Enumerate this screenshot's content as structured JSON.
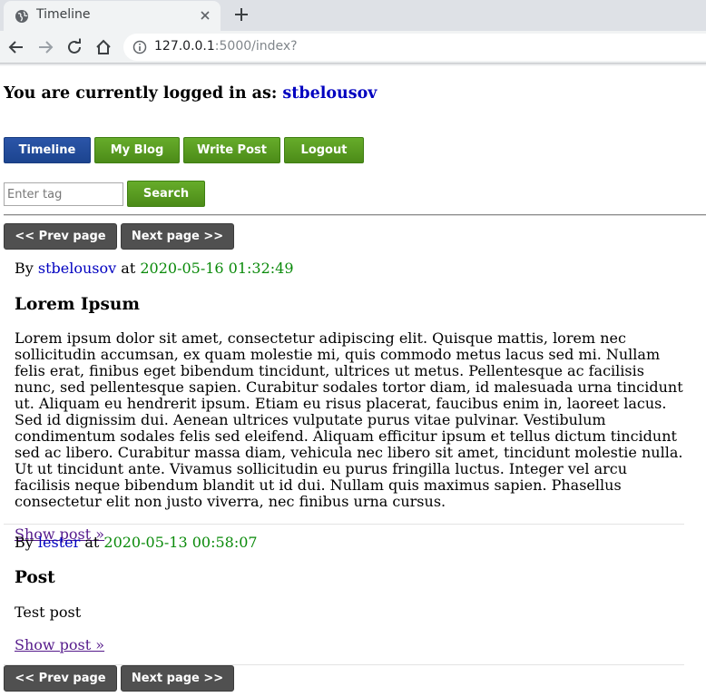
{
  "browser": {
    "tab_title": "Timeline",
    "url_host": "127.0.0.1",
    "url_rest": ":5000/index?"
  },
  "header": {
    "login_prefix": "You are currently logged in as:",
    "username": "stbelousov"
  },
  "nav": {
    "timeline": "Timeline",
    "my_blog": "My Blog",
    "write_post": "Write Post",
    "logout": "Logout"
  },
  "search": {
    "placeholder": "Enter tag",
    "button": "Search"
  },
  "pager": {
    "prev": "<< Prev page",
    "next": "Next page >>"
  },
  "posts": [
    {
      "by": "By",
      "author": "stbelousov",
      "at": "at",
      "timestamp": "2020-05-16 01:32:49",
      "title": "Lorem Ipsum",
      "body": "Lorem ipsum dolor sit amet, consectetur adipiscing elit. Quisque mattis, lorem nec sollicitudin accumsan, ex quam molestie mi, quis commodo metus lacus sed mi. Nullam felis erat, finibus eget bibendum tincidunt, ultrices ut metus. Pellentesque ac facilisis nunc, sed pellentesque sapien. Curabitur sodales tortor diam, id malesuada urna tincidunt ut. Aliquam eu hendrerit ipsum. Etiam eu risus placerat, faucibus enim in, laoreet lacus. Sed id dignissim dui. Aenean ultrices vulputate purus vitae pulvinar. Vestibulum condimentum sodales felis sed eleifend. Aliquam efficitur ipsum et tellus dictum tincidunt sed ac libero. Curabitur massa diam, vehicula nec libero sit amet, tincidunt molestie nulla. Ut ut tincidunt ante. Vivamus sollicitudin eu purus fringilla luctus. Integer vel arcu facilisis neque bibendum blandit ut id dui. Nullam quis maximus sapien. Phasellus consectetur elit non justo viverra, nec finibus urna cursus.",
      "show_link": "Show post »"
    },
    {
      "by": "By",
      "author": "lester",
      "at": "at",
      "timestamp": "2020-05-13 00:58:07",
      "title": "Post",
      "body": "Test post",
      "show_link": "Show post »"
    }
  ]
}
